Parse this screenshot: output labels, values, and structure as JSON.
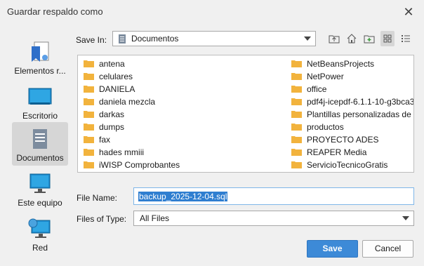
{
  "window": {
    "title": "Guardar respaldo como"
  },
  "places": [
    {
      "label": "Elementos r...",
      "icon": "recent-items-icon"
    },
    {
      "label": "Escritorio",
      "icon": "desktop-icon"
    },
    {
      "label": "Documentos",
      "icon": "documents-icon",
      "selected": true
    },
    {
      "label": "Este equipo",
      "icon": "computer-icon"
    },
    {
      "label": "Red",
      "icon": "network-icon"
    }
  ],
  "save_in": {
    "label": "Save In:",
    "value": "Documentos"
  },
  "files": {
    "col1": [
      "antena",
      "celulares",
      "DANIELA",
      "daniela mezcla",
      "darkas",
      "dumps",
      "fax",
      "hades mmiii",
      "iWISP Comprobantes"
    ],
    "col2": [
      "NetBeansProjects",
      "NetPower",
      "office",
      "pdf4j-icepdf-6.1.1-10-g3bca3",
      "Plantillas personalizadas de O",
      "productos",
      "PROYECTO ADES",
      "REAPER Media",
      "ServicioTecnicoGratis"
    ]
  },
  "file_name": {
    "label": "File Name:",
    "value": "backup_2025-12-04.sql"
  },
  "file_type": {
    "label": "Files of Type:",
    "value": "All Files"
  },
  "buttons": {
    "save": "Save",
    "cancel": "Cancel"
  },
  "colors": {
    "accent": "#3d8ad7",
    "selection": "#2f7ed0",
    "folder": "#f2b33d"
  }
}
